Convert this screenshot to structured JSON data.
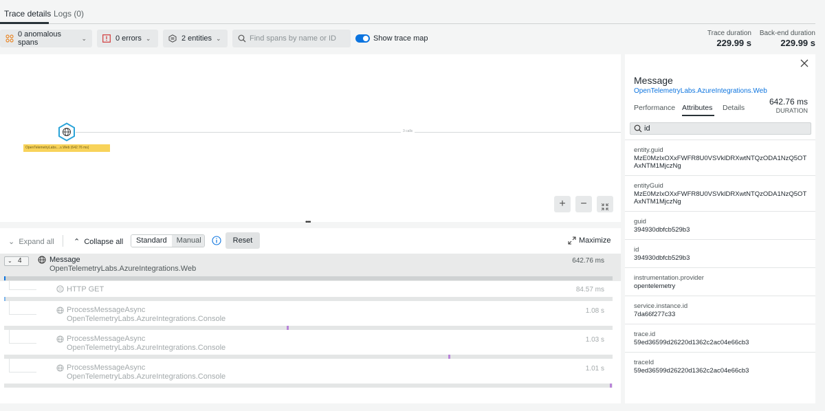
{
  "tabs": [
    {
      "label": "Trace details"
    },
    {
      "label": "Logs (0)"
    }
  ],
  "toolbar": {
    "anomalous_label": "0 anomalous spans",
    "errors_label": "0 errors",
    "entities_label": "2 entities",
    "search_placeholder": "Find spans by name or ID",
    "show_map_label": "Show trace map",
    "show_map_on": true
  },
  "durations": {
    "trace_label": "Trace duration",
    "trace_value": "229.99 s",
    "backend_label": "Back-end duration",
    "backend_value": "229.99 s"
  },
  "trace_map": {
    "node_label": "OpenTelemetryLabs....s.Web (642.76 ms)",
    "edge_label": "3 calls"
  },
  "span_list": {
    "expand_all": "Expand all",
    "collapse_all": "Collapse all",
    "view_standard": "Standard",
    "view_manual": "Manual",
    "reset_label": "Reset",
    "maximize_label": "Maximize",
    "root": {
      "count": "4",
      "name": "Message",
      "entity": "OpenTelemetryLabs.AzureIntegrations.Web",
      "duration": "642.76 ms"
    },
    "children": [
      {
        "name": "HTTP GET",
        "entity": "",
        "duration": "84.57 ms"
      },
      {
        "name": "ProcessMessageAsync",
        "entity": "OpenTelemetryLabs.AzureIntegrations.Console",
        "duration": "1.08 s"
      },
      {
        "name": "ProcessMessageAsync",
        "entity": "OpenTelemetryLabs.AzureIntegrations.Console",
        "duration": "1.03 s"
      },
      {
        "name": "ProcessMessageAsync",
        "entity": "OpenTelemetryLabs.AzureIntegrations.Console",
        "duration": "1.01 s"
      }
    ]
  },
  "panel": {
    "title": "Message",
    "entity": "OpenTelemetryLabs.AzureIntegrations.Web",
    "tabs": [
      "Performance",
      "Attributes",
      "Details"
    ],
    "active_tab": "Attributes",
    "duration_value": "642.76 ms",
    "duration_label": "DURATION",
    "search_value": "id",
    "attributes": [
      {
        "key": "entity.guid",
        "value": "MzE0MzIxOXxFWFR8U0VSVklDRXwtNTQzODA1NzQ5OTAxNTM1MjczNg"
      },
      {
        "key": "entityGuid",
        "value": "MzE0MzIxOXxFWFR8U0VSVklDRXwtNTQzODA1NzQ5OTAxNTM1MjczNg"
      },
      {
        "key": "guid",
        "value": "394930dbfcb529b3"
      },
      {
        "key": "id",
        "value": "394930dbfcb529b3"
      },
      {
        "key": "instrumentation.provider",
        "value": "opentelemetry"
      },
      {
        "key": "service.instance.id",
        "value": "7da66f277c33"
      },
      {
        "key": "trace.id",
        "value": "59ed36599d26220d1362c2ac04e66cb3"
      },
      {
        "key": "traceId",
        "value": "59ed36599d26220d1362c2ac04e66cb3"
      }
    ]
  },
  "colors": {
    "accent": "#0c74df",
    "node_highlight": "#f8d35a",
    "span_tick": "#b985d9"
  }
}
